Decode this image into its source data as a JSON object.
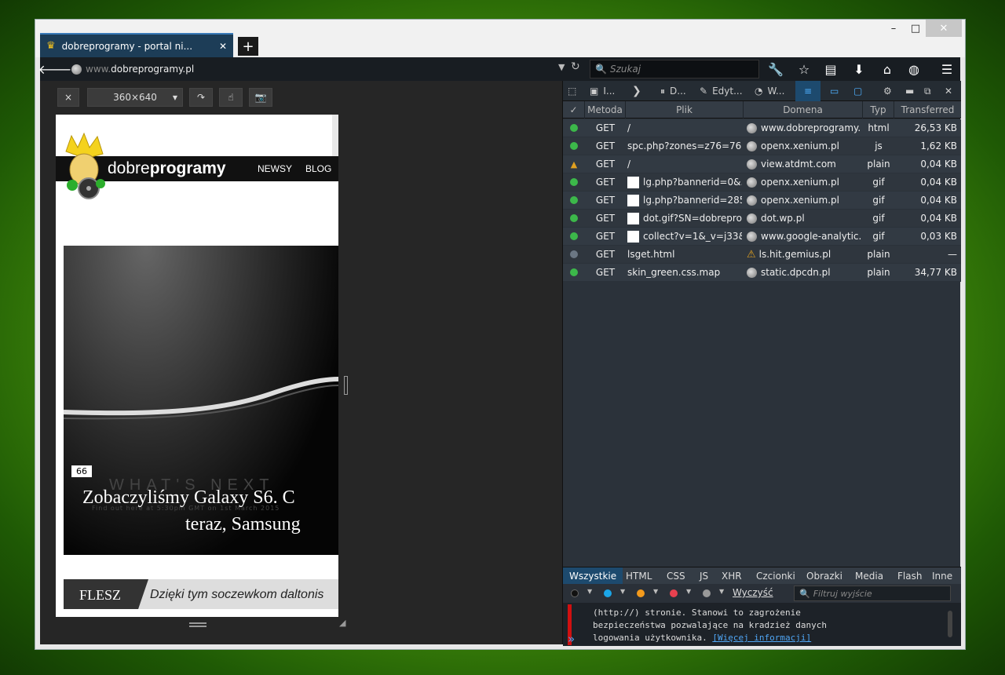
{
  "window": {
    "min": "–",
    "max": "□",
    "close": "✕"
  },
  "tab": {
    "title": "dobreprogramy - portal ni...",
    "close": "✕",
    "new": "+"
  },
  "urlbar": {
    "prefix": "www.",
    "domain": "dobreprogramy.pl"
  },
  "search": {
    "placeholder": "Szukaj"
  },
  "rdm": {
    "close": "×",
    "size": "360×640"
  },
  "site": {
    "logo_light": "dobre",
    "logo_bold": "programy",
    "nav": [
      "NEWSY",
      "BLOG"
    ],
    "hero_bg_big": "WHAT'S NEXT",
    "hero_bg_small": "Find out here at 5:30pm GMT on 1st March 2015",
    "comment_count": "66",
    "headline_1": "Zobaczyliśmy Galaxy S6. C",
    "headline_2": "teraz, Samsung",
    "flesz_label": "FLESZ",
    "flesz_text": "Dzięki tym soczewkom daltonis"
  },
  "devtools": {
    "tools": [
      "I...",
      "D...",
      "Edyt...",
      "W..."
    ],
    "columns": {
      "status": "✓",
      "method": "Metoda",
      "file": "Plik",
      "domain": "Domena",
      "type": "Typ",
      "transferred": "Transferred"
    },
    "rows": [
      {
        "status": "#3cb84a",
        "method": "GET",
        "file": "/",
        "thumb": false,
        "domain": "www.dobreprogramy...",
        "dicon": "globe",
        "type": "html",
        "size": "26,53 KB"
      },
      {
        "status": "#3cb84a",
        "method": "GET",
        "file": "spc.php?zones=z76=76|z...",
        "thumb": false,
        "domain": "openx.xenium.pl",
        "dicon": "globe",
        "type": "js",
        "size": "1,62 KB"
      },
      {
        "status": "warn",
        "method": "GET",
        "file": "/",
        "thumb": false,
        "domain": "view.atdmt.com",
        "dicon": "globe",
        "type": "plain",
        "size": "0,04 KB"
      },
      {
        "status": "#3cb84a",
        "method": "GET",
        "file": "lg.php?bannerid=0&...",
        "thumb": true,
        "domain": "openx.xenium.pl",
        "dicon": "globe",
        "type": "gif",
        "size": "0,04 KB"
      },
      {
        "status": "#3cb84a",
        "method": "GET",
        "file": "lg.php?bannerid=285...",
        "thumb": true,
        "domain": "openx.xenium.pl",
        "dicon": "globe",
        "type": "gif",
        "size": "0,04 KB"
      },
      {
        "status": "#3cb84a",
        "method": "GET",
        "file": "dot.gif?SN=dobrepro...",
        "thumb": true,
        "domain": "dot.wp.pl",
        "dicon": "globe",
        "type": "gif",
        "size": "0,04 KB"
      },
      {
        "status": "#3cb84a",
        "method": "GET",
        "file": "collect?v=1&_v=j33&...",
        "thumb": true,
        "domain": "www.google-analytic...",
        "dicon": "globe",
        "type": "gif",
        "size": "0,03 KB"
      },
      {
        "status": "#6b7784",
        "method": "GET",
        "file": "lsget.html",
        "thumb": false,
        "domain": "ls.hit.gemius.pl",
        "dicon": "warn",
        "type": "plain",
        "size": "—"
      },
      {
        "status": "#3cb84a",
        "method": "GET",
        "file": "skin_green.css.map",
        "thumb": false,
        "domain": "static.dpcdn.pl",
        "dicon": "globe",
        "type": "plain",
        "size": "34,77 KB"
      }
    ],
    "filters": [
      "Wszystkie",
      "HTML",
      "CSS",
      "JS",
      "XHR",
      "Czcionki",
      "Obrazki",
      "Media",
      "Flash",
      "Inne"
    ],
    "clear_label": "Wyczyść",
    "filter_placeholder": "Filtruj wyjście",
    "console": {
      "line1": "(http://) stronie. Stanowi to zagrożenie",
      "line2": "bezpieczeństwa pozwalające na kradzież danych",
      "line3": "logowania użytkownika.",
      "link": "[Więcej informacji]",
      "prompt": "»"
    }
  },
  "colors": {
    "accent": "#3a7ab8",
    "ok": "#3cb84a",
    "warn": "#e0a020"
  }
}
